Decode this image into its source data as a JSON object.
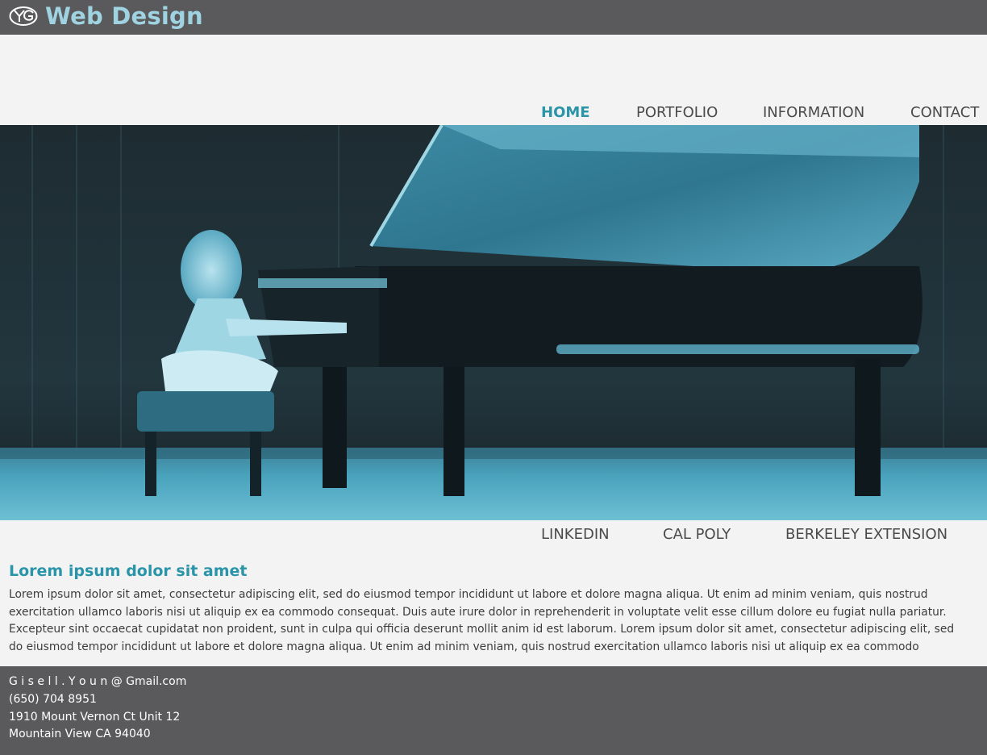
{
  "header": {
    "logo_icon": "yg-monogram-icon",
    "brand": "Web Design"
  },
  "nav": {
    "items": [
      {
        "label": "HOME",
        "active": true
      },
      {
        "label": "PORTFOLIO",
        "active": false
      },
      {
        "label": "INFORMATION",
        "active": false
      },
      {
        "label": "CONTACT",
        "active": false
      }
    ]
  },
  "hero": {
    "image": "piano-performance-photo"
  },
  "links": {
    "items": [
      "LINKEDIN",
      "CAL POLY",
      "BERKELEY EXTENSION"
    ]
  },
  "content": {
    "title": "Lorem ipsum dolor sit amet",
    "body": "Lorem ipsum dolor sit amet, consectetur adipiscing elit, sed do eiusmod tempor incididunt ut labore et dolore magna aliqua. Ut enim ad minim veniam, quis nostrud exercitation ullamco laboris nisi ut aliquip ex ea commodo consequat. Duis aute irure dolor in reprehenderit in voluptate velit esse cillum dolore eu fugiat nulla pariatur. Excepteur sint occaecat cupidatat non proident, sunt in culpa qui officia deserunt mollit anim id est laborum.  Lorem ipsum dolor sit amet, consectetur adipiscing elit, sed do eiusmod tempor incididunt ut labore et dolore magna aliqua. Ut enim ad minim veniam, quis nostrud exercitation ullamco laboris nisi ut aliquip ex ea commodo consequat. Duis aute irure dolor in reprehenderit in"
  },
  "footer": {
    "email": "G i s e l l . Y o u n @ Gmail.com",
    "phone": "(650) 704 8951",
    "address1": "1910 Mount Vernon Ct Unit 12",
    "address2": "Mountain View CA 94040"
  },
  "colors": {
    "bar": "#5a5a5c",
    "accent": "#2a94a8",
    "brand": "#9fd3e1",
    "page": "#f3f3f3"
  }
}
